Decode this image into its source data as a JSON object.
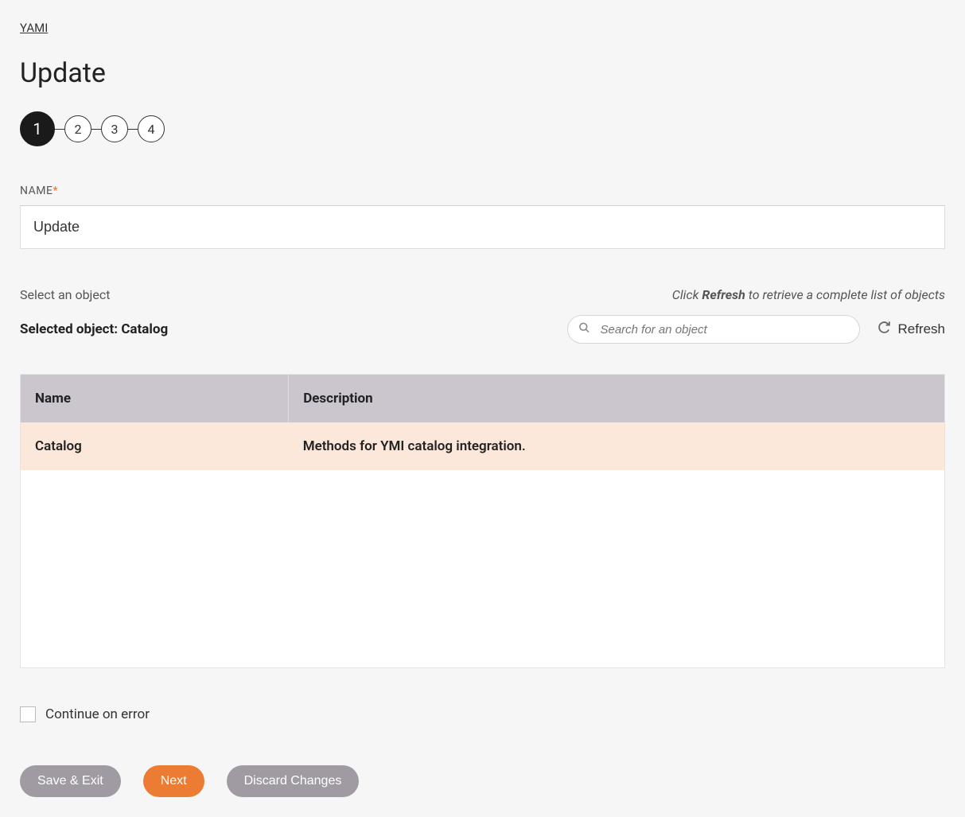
{
  "breadcrumb": "YAMI",
  "page_title": "Update",
  "stepper": {
    "steps": [
      "1",
      "2",
      "3",
      "4"
    ],
    "active_index": 0
  },
  "name_field": {
    "label": "NAME",
    "required_marker": "*",
    "value": "Update"
  },
  "object_section": {
    "select_label": "Select an object",
    "refresh_hint_prefix": "Click ",
    "refresh_hint_strong": "Refresh",
    "refresh_hint_suffix": " to retrieve a complete list of objects",
    "selected_label_prefix": "Selected object: ",
    "selected_value": "Catalog",
    "search_placeholder": "Search for an object",
    "refresh_button": "Refresh"
  },
  "table": {
    "headers": {
      "name": "Name",
      "description": "Description"
    },
    "rows": [
      {
        "name": "Catalog",
        "description": "Methods for YMI catalog integration.",
        "selected": true
      }
    ]
  },
  "continue_on_error": {
    "label": "Continue on error",
    "checked": false
  },
  "buttons": {
    "save_exit": "Save & Exit",
    "next": "Next",
    "discard": "Discard Changes"
  }
}
